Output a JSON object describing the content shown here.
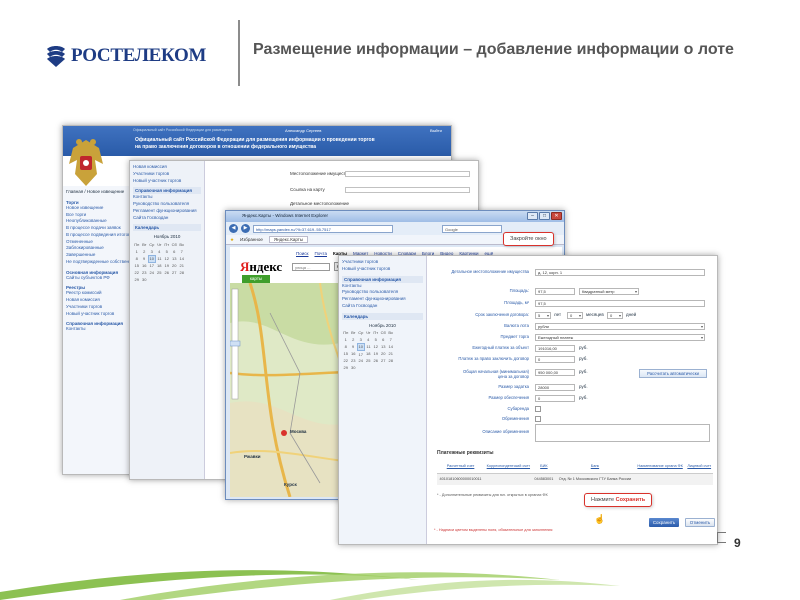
{
  "slide": {
    "brand": "РОСТЕЛЕКОМ",
    "title": "Размещение  информации – добавление информации о лоте",
    "page_number": "9",
    "colors": {
      "brand": "#1e3c84",
      "accent": "#d9322b",
      "swoosh": "#7cb64a"
    }
  },
  "portal": {
    "user": "Александр Сергеев",
    "exit": "Выйти",
    "header_line1": "Официальный сайт Российской Федерации для размещения информации о проведении торгов",
    "header_line2": "на право заключения договоров в отношении федерального имущества",
    "tiny_link": "Официальный сайт Российской Федерации для размещения",
    "breadcrumb": "Главная / Новое извещение",
    "sidebar": {
      "torgi": "Торги",
      "torgi_items": [
        "Новое извещение",
        "Все торги",
        "Неопубликованные",
        "В процессе подачи заявок",
        "В процессе подведения итогов",
        "Отмененные",
        "Заблокированные",
        "Завершенные",
        "Не подтвержденные собственником"
      ],
      "basic": "Основная информация",
      "basic_items": [
        "Сайты субъектов РФ"
      ],
      "registry": "Реестры",
      "registry_items": [
        "Реестр комиссий",
        "Новая комиссия",
        "Участники торгов",
        "Новый участник торгов"
      ],
      "reference": "Справочная информация",
      "reference_items": [
        "Контакты",
        "Руководство пользователя",
        "Регламент функционирования",
        "Сайта Госвоздан"
      ],
      "calendar": "Календарь",
      "month": "Ноябрь 2010",
      "weekdays": [
        "Пн",
        "Вт",
        "Ср",
        "Чт",
        "Пт",
        "Сб",
        "Вс"
      ],
      "weeks": [
        [
          "1",
          "2",
          "3",
          "4",
          "5",
          "6",
          "7"
        ],
        [
          "8",
          "9",
          "10",
          "11",
          "12",
          "13",
          "14"
        ],
        [
          "15",
          "16",
          "17",
          "18",
          "19",
          "20",
          "21"
        ],
        [
          "22",
          "23",
          "24",
          "25",
          "26",
          "27",
          "28"
        ],
        [
          "29",
          "30",
          "",
          "",
          "",
          "",
          ""
        ]
      ]
    },
    "top_items": [
      "Новая комиссия",
      "Участники торгов",
      "Новый участник торгов"
    ],
    "form_top": {
      "location_label": "Местоположение имущества",
      "map_link_label": "Ссылка на карту",
      "detail_label": "Детальное местоположение"
    }
  },
  "browser": {
    "title": "Яндекс.Карты - Windows Internet Explorer",
    "url": "http://maps.yandex.ru/?ll=37.619..55.7517",
    "search_placeholder": "Google",
    "favorites": "Избранное",
    "tab": "Яндекс.Карты",
    "yandex": {
      "menu": [
        "Поиск",
        "Почта",
        "Карты",
        "Маркет",
        "Новости",
        "Словари",
        "Блоги",
        "Видео",
        "Картинки",
        "ещё"
      ],
      "logo_first": "Я",
      "logo_rest": "ндекс",
      "section": "карты",
      "search_value": "улица ...",
      "search_button": "Найти",
      "route_link": "Поиск по...",
      "city_labels": [
        "Москва",
        "Ржавки",
        "Курск"
      ]
    }
  },
  "lot_form": {
    "rows": [
      {
        "label": "Детальное местоположение имущества",
        "value": "д. 12, корп. 1"
      },
      {
        "label": "Площадь:",
        "value": "97,5",
        "unit": "Квадратный метр"
      },
      {
        "label": "Площадь, м²",
        "value": "97,5"
      },
      {
        "label": "Срок заключения договора:",
        "value": "5",
        "years": "лет",
        "months_value": "0",
        "months": "месяцев",
        "days_value": "0",
        "days": "дней"
      },
      {
        "label": "Валюта лота",
        "value": "рубли"
      },
      {
        "label": "Предмет торга",
        "value": "Ежегодный платеж"
      },
      {
        "label": "Ежегодный платеж за объект",
        "value": "191016,00",
        "unit": "руб."
      },
      {
        "label": "Платеж за право заключить договор",
        "value": "0",
        "unit": "руб."
      },
      {
        "label": "Общая начальная (минимальная) цена за договор",
        "value": "950 000,00",
        "unit": "руб."
      },
      {
        "label": "Размер задатка",
        "value": "28000",
        "unit": "руб."
      },
      {
        "label": "Размер обеспечения",
        "value": "0",
        "unit": "руб."
      },
      {
        "label": "Субаренда"
      },
      {
        "label": "Обременения"
      },
      {
        "label": "Описание обременения"
      }
    ],
    "calc_button": "Рассчитать автоматически",
    "requisites_title": "Платежные реквизиты",
    "table_headers": [
      "Расчетный счет",
      "Корреспондентский счет",
      "БИК",
      "Банк",
      "Наименование органа ФК",
      "Лицевой счет"
    ],
    "table_row": [
      "40101810600000010011",
      "",
      "044583001",
      "Отд. № 1 Московского ГТУ Банка России",
      "",
      ""
    ],
    "table_note": "* - Дополнительные реквизиты для юл. открытых в органах ФК",
    "footnote": "* - Надписи цветом выделены поля, обязательные для заполнения",
    "save_button": "Сохранить",
    "cancel_button": "Отменить"
  },
  "callouts": {
    "close_window": "Закройте окно",
    "save_prefix": "Нажмите",
    "save_action": "Сохранить"
  }
}
